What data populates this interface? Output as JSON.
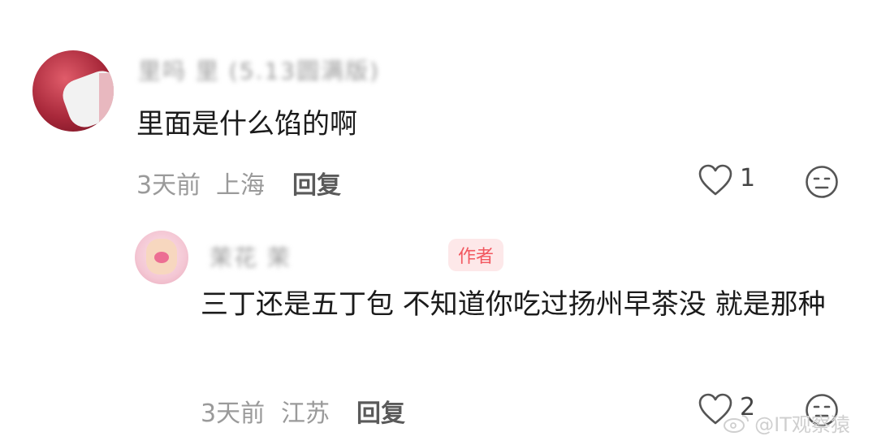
{
  "comments": [
    {
      "username": "里吗 里 (5.13圆满版)",
      "text": "里面是什么馅的啊",
      "time": "3天前",
      "location": "上海",
      "reply_label": "回复",
      "likes": "1",
      "like_icon": "heart-icon",
      "dislike_icon": "meh-face-icon"
    },
    {
      "username": "茉花 茉",
      "badge": "作者",
      "text": "三丁还是五丁包 不知道你吃过扬州早茶没 就是那种",
      "time": "3天前",
      "location": "江苏",
      "reply_label": "回复",
      "likes": "2",
      "like_icon": "heart-icon",
      "dislike_icon": "meh-face-icon"
    }
  ],
  "watermark": "@IT观察猿"
}
